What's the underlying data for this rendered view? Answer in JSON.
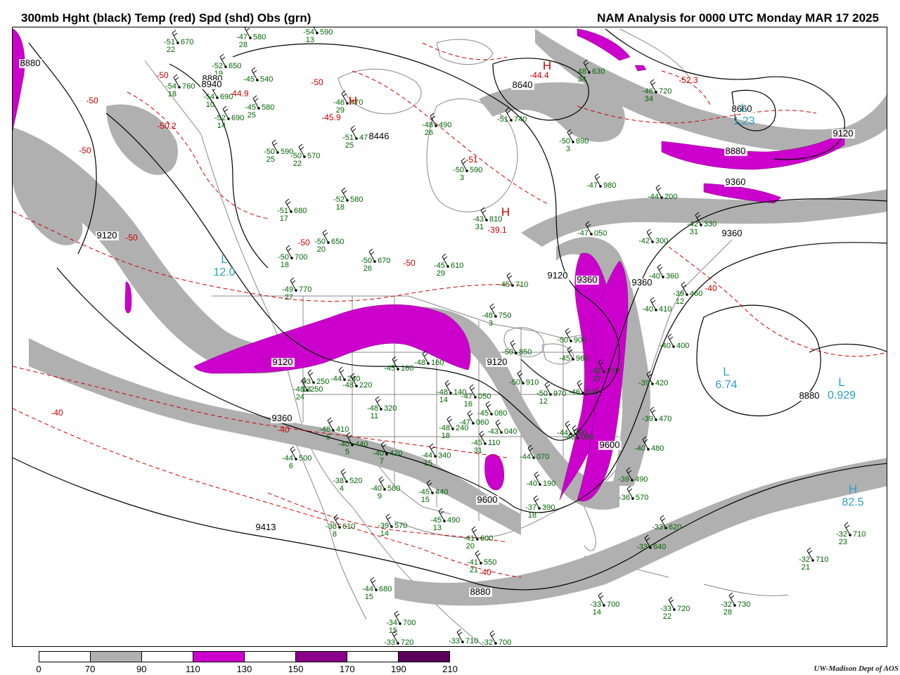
{
  "header": {
    "left_title": "300mb Hght (black) Temp (red) Spd (shd) Obs (grn)",
    "right_title": "NAM Analysis for 0000 UTC Monday  MAR 17 2025"
  },
  "colors": {
    "height_contour": "#000000",
    "temperature_contour": "#cc0000",
    "speed_70_90": "#b0b0b0",
    "speed_90_110": "#ffffff",
    "speed_110_130": "#cc00cc",
    "speed_130_150": "#ffffff",
    "speed_150_170": "#8a008a",
    "speed_170_190": "#ffffff",
    "speed_190_210": "#5a005a",
    "observation": "#006400",
    "speed_max_label": "#2aa0c0",
    "geography": "#888888"
  },
  "legend": {
    "ticks": [
      "0",
      "70",
      "90",
      "110",
      "130",
      "150",
      "170",
      "190",
      "210"
    ],
    "segments": [
      "#ffffff",
      "#b0b0b0",
      "#ffffff",
      "#cc00cc",
      "#ffffff",
      "#8a008a",
      "#ffffff",
      "#5a005a"
    ]
  },
  "map": {
    "height_labels": [
      "8880",
      "8880",
      "8940",
      "8640",
      "8446",
      "8660",
      "8880",
      "9120",
      "9120",
      "9120",
      "9120",
      "9360",
      "9360",
      "9360",
      "9360",
      "9600",
      "9600",
      "9413",
      "8880",
      "8880",
      "9120",
      "9360"
    ],
    "temperature_labels": [
      "-50",
      "-50",
      "-50",
      "-50",
      "-50.2",
      "-44.9",
      "-45.9",
      "-44.4",
      "-52.3",
      "-50",
      "-50",
      "-39.1",
      "-51",
      "-50",
      "-40",
      "-40",
      "-40",
      "-40"
    ],
    "highs_lows": [
      {
        "symbol": "L",
        "value": "12.0"
      },
      {
        "symbol": "L",
        "value": "6.74"
      },
      {
        "symbol": "L",
        "value": "1.23"
      },
      {
        "symbol": "H",
        "value": "82.5"
      },
      {
        "symbol": "L",
        "value": "0.929"
      },
      {
        "symbol": "H",
        "value": ""
      },
      {
        "symbol": "H",
        "value": ""
      },
      {
        "symbol": "H",
        "value": ""
      }
    ],
    "observations": [
      {
        "temp": "-47",
        "height": "580",
        "dew": "28"
      },
      {
        "temp": "-51",
        "height": "670",
        "dew": "22"
      },
      {
        "temp": "-54",
        "height": "590",
        "dew": "13"
      },
      {
        "temp": "-52",
        "height": "650",
        "dew": "19"
      },
      {
        "temp": "-45",
        "height": "540",
        "dew": ""
      },
      {
        "temp": "-54",
        "height": "760",
        "dew": "18"
      },
      {
        "temp": "-54",
        "height": "690",
        "dew": "10"
      },
      {
        "temp": "-45",
        "height": "580",
        "dew": "25"
      },
      {
        "temp": "-52",
        "height": "690",
        "dew": "14"
      },
      {
        "temp": "-46",
        "height": "470",
        "dew": "29"
      },
      {
        "temp": "-51",
        "height": "470",
        "dew": "25"
      },
      {
        "temp": "-48",
        "height": "490",
        "dew": "26"
      },
      {
        "temp": "-48",
        "height": "630",
        "dew": "34"
      },
      {
        "temp": "-46",
        "height": "720",
        "dew": "34"
      },
      {
        "temp": "-51",
        "height": "740",
        "dew": ""
      },
      {
        "temp": "-50",
        "height": "890",
        "dew": "3"
      },
      {
        "temp": "-50",
        "height": "590",
        "dew": "3"
      },
      {
        "temp": "-50",
        "height": "590",
        "dew": "25"
      },
      {
        "temp": "-50",
        "height": "570",
        "dew": "22"
      },
      {
        "temp": "-52",
        "height": "580",
        "dew": "18"
      },
      {
        "temp": "-51",
        "height": "680",
        "dew": "17"
      },
      {
        "temp": "-50",
        "height": "650",
        "dew": "20"
      },
      {
        "temp": "-50",
        "height": "670",
        "dew": "26"
      },
      {
        "temp": "-50",
        "height": "700",
        "dew": "18"
      },
      {
        "temp": "-45",
        "height": "610",
        "dew": "29"
      },
      {
        "temp": "-43",
        "height": "810",
        "dew": "31"
      },
      {
        "temp": "-45",
        "height": "710",
        "dew": ""
      },
      {
        "temp": "-47",
        "height": "980",
        "dew": ""
      },
      {
        "temp": "-44",
        "height": "200",
        "dew": ""
      },
      {
        "temp": "-47",
        "height": "050",
        "dew": ""
      },
      {
        "temp": "-42",
        "height": "330",
        "dew": "31"
      },
      {
        "temp": "-42",
        "height": "300",
        "dew": ""
      },
      {
        "temp": "-49",
        "height": "770",
        "dew": "27"
      },
      {
        "temp": "-48",
        "height": "750",
        "dew": "3"
      },
      {
        "temp": "-40",
        "height": "360",
        "dew": ""
      },
      {
        "temp": "-39",
        "height": "460",
        "dew": "12"
      },
      {
        "temp": "-40",
        "height": "410",
        "dew": ""
      },
      {
        "temp": "-40",
        "height": "400",
        "dew": ""
      },
      {
        "temp": "-50",
        "height": "900",
        "dew": ""
      },
      {
        "temp": "-50",
        "height": "850",
        "dew": ""
      },
      {
        "temp": "-45",
        "height": "960",
        "dew": ""
      },
      {
        "temp": "-50",
        "height": "910",
        "dew": ""
      },
      {
        "temp": "-50",
        "height": "970",
        "dew": "12"
      },
      {
        "temp": "-46",
        "height": "020",
        "dew": ""
      },
      {
        "temp": "-42",
        "height": "270",
        "dew": "27"
      },
      {
        "temp": "-39",
        "height": "420",
        "dew": ""
      },
      {
        "temp": "-39",
        "height": "470",
        "dew": ""
      },
      {
        "temp": "-40",
        "height": "480",
        "dew": ""
      },
      {
        "temp": "-39",
        "height": "490",
        "dew": ""
      },
      {
        "temp": "-36",
        "height": "570",
        "dew": ""
      },
      {
        "temp": "-33",
        "height": "620",
        "dew": ""
      },
      {
        "temp": "-33",
        "height": "640",
        "dew": ""
      },
      {
        "temp": "-32",
        "height": "710",
        "dew": "23"
      },
      {
        "temp": "-32",
        "height": "710",
        "dew": "21"
      },
      {
        "temp": "-33",
        "height": "700",
        "dew": "14"
      },
      {
        "temp": "-33",
        "height": "720",
        "dew": "22"
      },
      {
        "temp": "-32",
        "height": "730",
        "dew": "28"
      },
      {
        "temp": "-44",
        "height": "060",
        "dew": ""
      },
      {
        "temp": "-44",
        "height": "070",
        "dew": ""
      },
      {
        "temp": "-43",
        "height": "040",
        "dew": ""
      },
      {
        "temp": "-45",
        "height": "080",
        "dew": ""
      },
      {
        "temp": "-47",
        "height": "050",
        "dew": "16"
      },
      {
        "temp": "-45",
        "height": "110",
        "dew": "31"
      },
      {
        "temp": "-47",
        "height": "060",
        "dew": ""
      },
      {
        "temp": "-48",
        "height": "140",
        "dew": "14"
      },
      {
        "temp": "-48",
        "height": "160",
        "dew": ""
      },
      {
        "temp": "-43",
        "height": "250",
        "dew": "13"
      },
      {
        "temp": "-44",
        "height": "240",
        "dew": ""
      },
      {
        "temp": "-48",
        "height": "240",
        "dew": "18"
      },
      {
        "temp": "-45",
        "height": "160",
        "dew": ""
      },
      {
        "temp": "-48",
        "height": "220",
        "dew": ""
      },
      {
        "temp": "-48",
        "height": "250",
        "dew": "24"
      },
      {
        "temp": "-48",
        "height": "320",
        "dew": "11"
      },
      {
        "temp": "-48",
        "height": "410",
        "dew": "5"
      },
      {
        "temp": "-40",
        "height": "440",
        "dew": "5"
      },
      {
        "temp": "-44",
        "height": "500",
        "dew": "6"
      },
      {
        "temp": "-40",
        "height": "420",
        "dew": "7"
      },
      {
        "temp": "-44",
        "height": "340",
        "dew": "15"
      },
      {
        "temp": "-38",
        "height": "520",
        "dew": "4"
      },
      {
        "temp": "-40",
        "height": "580",
        "dew": "9"
      },
      {
        "temp": "-45",
        "height": "440",
        "dew": "15"
      },
      {
        "temp": "-45",
        "height": "490",
        "dew": "13"
      },
      {
        "temp": "-39",
        "height": "570",
        "dew": "14"
      },
      {
        "temp": "-38",
        "height": "610",
        "dew": "8"
      },
      {
        "temp": "-41",
        "height": "600",
        "dew": "20"
      },
      {
        "temp": "-41",
        "height": "550",
        "dew": "21"
      },
      {
        "temp": "-44",
        "height": "680",
        "dew": "15"
      },
      {
        "temp": "-34",
        "height": "700",
        "dew": "15"
      },
      {
        "temp": "-33",
        "height": "720",
        "dew": ""
      },
      {
        "temp": "-33",
        "height": "710",
        "dew": ""
      },
      {
        "temp": "-32",
        "height": "700",
        "dew": ""
      },
      {
        "temp": "-37",
        "height": "390",
        "dew": "18"
      },
      {
        "temp": "-40",
        "height": "190",
        "dew": ""
      },
      {
        "temp": "-46",
        "height": "080",
        "dew": ""
      }
    ]
  },
  "credit": "UW-Madison  Dept of AOS"
}
